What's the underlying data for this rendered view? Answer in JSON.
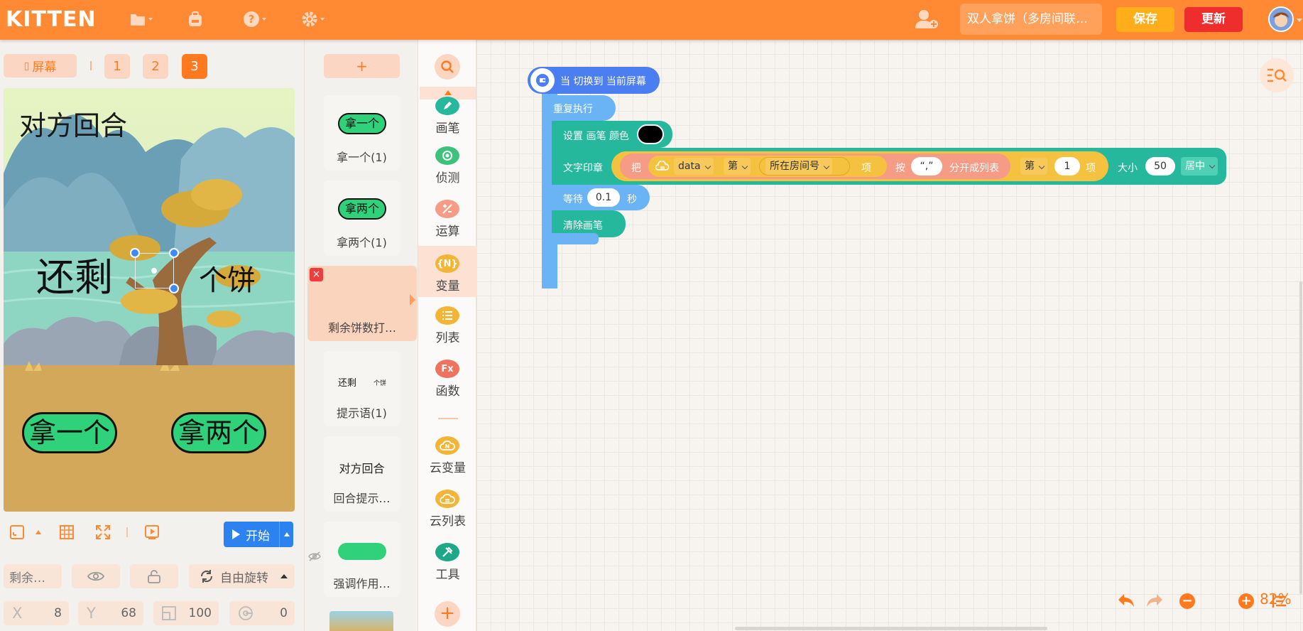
{
  "app": {
    "logo": "KITTEN",
    "project_name": "双人拿饼（多房间联…",
    "save_label": "保存",
    "update_label": "更新"
  },
  "topbar_icons": [
    "folder-icon",
    "backpack-icon",
    "help-icon",
    "settings-icon",
    "add-user-icon"
  ],
  "stage_panel": {
    "screen_label": "屏幕",
    "screens": [
      "1",
      "2",
      "3"
    ],
    "active_screen": "3",
    "stage": {
      "title": "对方回合",
      "left_text": "还剩",
      "right_text": "个饼",
      "button_one": "拿一个",
      "button_two": "拿两个"
    },
    "start_label": "开始",
    "sprite_name": "剩余…",
    "rotation_label": "自由旋转",
    "x_label": "X",
    "x_value": "8",
    "y_label": "Y",
    "y_value": "68",
    "size_value": "100",
    "rotation_value": "0"
  },
  "sprites": {
    "add_label": "+",
    "items": [
      {
        "label": "拿一个(1)",
        "thumb": "拿一个"
      },
      {
        "label": "拿两个(1)",
        "thumb": "拿两个"
      },
      {
        "label": "剩余饼数打…",
        "close": "×"
      },
      {
        "label": "提示语(1)",
        "thumb_left": "还剩",
        "thumb_right": "个饼"
      },
      {
        "label": "回合提示…",
        "thumb": "对方回合"
      },
      {
        "label": "强调作用…"
      }
    ]
  },
  "categories": [
    {
      "label": "画笔",
      "color": "#25b89d",
      "icon": "pen-icon"
    },
    {
      "label": "侦测",
      "color": "#3cc27a",
      "icon": "detect-icon"
    },
    {
      "label": "运算",
      "color": "#f59b86",
      "icon": "operator-icon"
    },
    {
      "label": "变量",
      "color": "#f4b435",
      "icon": "variable-icon",
      "text": "{N}"
    },
    {
      "label": "列表",
      "color": "#f4b435",
      "icon": "list-icon"
    },
    {
      "label": "函数",
      "color": "#f0735f",
      "icon": "function-icon",
      "text": "Fx"
    },
    {
      "label": "云变量",
      "color": "#f4b435",
      "icon": "cloud-variable-icon",
      "text": "N"
    },
    {
      "label": "云列表",
      "color": "#f4b435",
      "icon": "cloud-list-icon"
    },
    {
      "label": "工具",
      "color": "#1ea88a",
      "icon": "tools-icon"
    }
  ],
  "blocks": {
    "hat": "当 切换到 当前屏幕",
    "repeat": "重复执行",
    "set_pen_color": "设置 画笔 颜色",
    "stamp_text": "文字印章",
    "ba": "把",
    "data_var": "data",
    "di": "第",
    "room_no": "所在房间号",
    "xiang": "项",
    "an": "按",
    "separator": "“,”",
    "split_label": "分开成列表",
    "di2": "第",
    "index": "1",
    "xiang2": "项",
    "size_label": "大小",
    "size_value": "50",
    "align": "居中",
    "wait_label": "等待",
    "wait_value": "0.1",
    "wait_unit": "秒",
    "clear_pen": "清除画笔"
  },
  "workspace": {
    "zoom": "82%"
  },
  "colors": {
    "accent": "#ff8a33",
    "save": "#ffad1a",
    "update": "#ef2d2d",
    "start": "#2b82f0",
    "pen_color": "#000000"
  }
}
